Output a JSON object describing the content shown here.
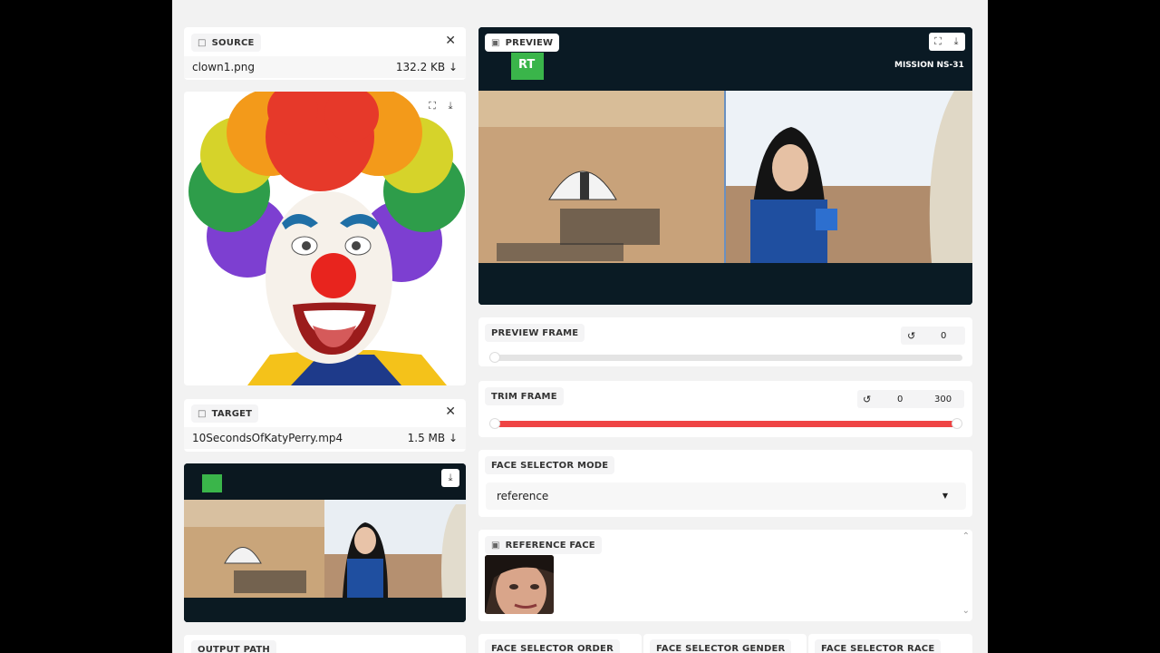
{
  "source": {
    "label": "SOURCE",
    "file_name": "clown1.png",
    "file_size": "132.2 KB ↓",
    "close_glyph": "✕"
  },
  "target": {
    "label": "TARGET",
    "file_name": "10SecondsOfKatyPerry.mp4",
    "file_size": "1.5 MB ↓",
    "close_glyph": "✕"
  },
  "output": {
    "label": "OUTPUT PATH"
  },
  "preview": {
    "label": "PREVIEW",
    "logo_text": "RT",
    "overlay_text": "MISSION NS-31"
  },
  "preview_frame": {
    "label": "PREVIEW FRAME",
    "value": "0",
    "slider_fraction": 0
  },
  "trim_frame": {
    "label": "TRIM FRAME",
    "start": "0",
    "end": "300",
    "start_fraction": 0,
    "end_fraction": 1
  },
  "face_selector_mode": {
    "label": "FACE SELECTOR MODE",
    "value": "reference",
    "caret": "▼"
  },
  "reference_face": {
    "label": "REFERENCE FACE"
  },
  "bottom_labels": {
    "order": "FACE SELECTOR ORDER",
    "gender": "FACE SELECTOR GENDER",
    "race": "FACE SELECTOR RACE"
  },
  "icons": {
    "file": "file-icon",
    "image": "image-icon",
    "fullscreen": "fullscreen-icon",
    "download": "download-icon",
    "reset": "reset-icon",
    "scroll_up": "scroll-up-icon",
    "scroll_down": "scroll-down-icon"
  },
  "colors": {
    "trim_track": "#ef4444",
    "accent_chip": "#f4f4f5"
  }
}
